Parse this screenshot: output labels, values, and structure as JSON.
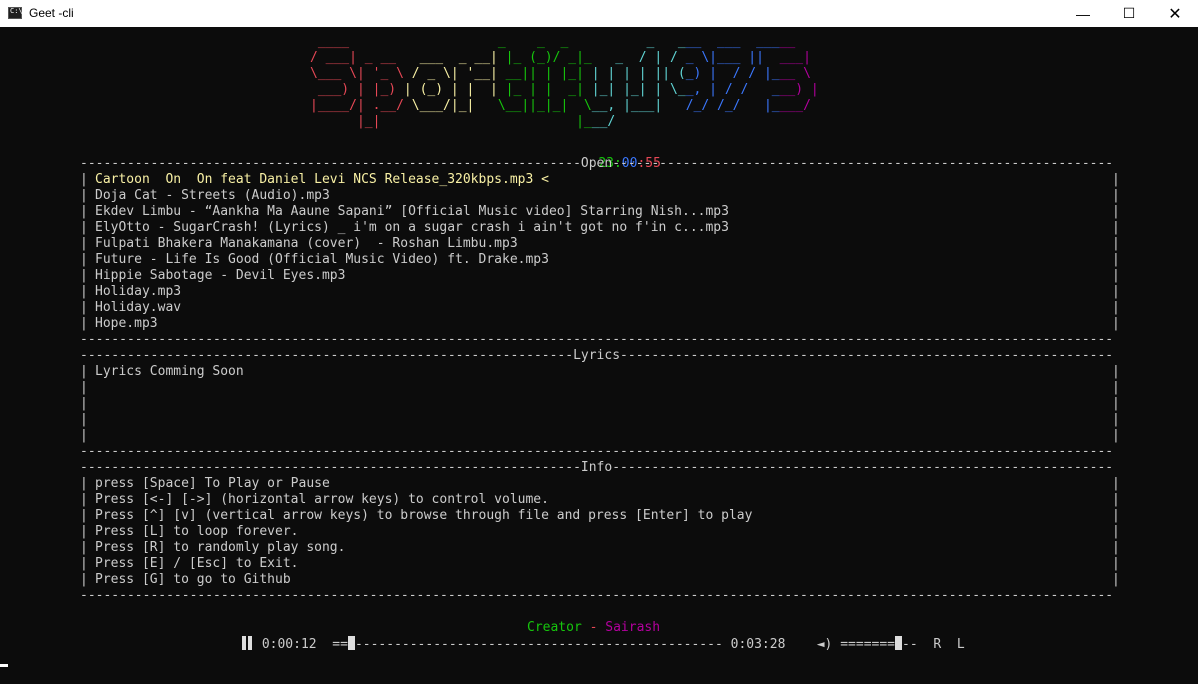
{
  "window": {
    "title": "Geet -cli",
    "minimize_glyph": "—",
    "maximize_glyph": "☐",
    "close_glyph": "✕"
  },
  "logo_lines": [
    " ____                   _    _  _          _   ___  ___  _____",
    "/ ___| _ __   ___  _ __| |_ (_)/ _|_   _  / | / _ \\|___ ||  ___|",
    "\\___ \\| '_ \\ / _ \\| '__| __|| | |_| | | | | || (_) |  / / |___ \\",
    " ___) | |_) | (_) | |  | |_ | |  _| |_| |_| | \\__, | / /   ___) |",
    "|____/| .__/ \\___/|_|   \\__||_|_|  \\__, |___|   /_/ /_/   |____/",
    "      |_|                         |___/"
  ],
  "logo_colors": [
    "#e74856",
    "#f9f1a5",
    "#16c60c",
    "#61d6d6",
    "#3b78ff",
    "#b4009e"
  ],
  "clock": {
    "hours": "23",
    "colon1": ":",
    "minutes": "00",
    "colon2": ":",
    "seconds": "55"
  },
  "sections": {
    "open_title": "Open",
    "lyrics_title": "Lyrics",
    "info_title": "Info"
  },
  "files": [
    "Cartoon  On  On feat Daniel Levi NCS Release_320kbps.mp3 <",
    "Doja Cat - Streets (Audio).mp3",
    "Ekdev Limbu - “Aankha Ma Aaune Sapani” [Official Music video] Starring Nish...mp3",
    "ElyOtto - SugarCrash! (Lyrics) _ i'm on a sugar crash i ain't got no f'in c...mp3",
    "Fulpati Bhakera Manakamana (cover)  - Roshan Limbu.mp3",
    "Future - Life Is Good (Official Music Video) ft. Drake.mp3",
    "Hippie Sabotage - Devil Eyes.mp3",
    "Holiday.mp3",
    "Holiday.wav",
    "Hope.mp3"
  ],
  "lyrics": [
    "Lyrics Comming Soon",
    "",
    "",
    "",
    ""
  ],
  "info": [
    "press [Space] To Play or Pause",
    "Press [<-] [->] (horizontal arrow keys) to control volume.",
    "Press [^] [v] (vertical arrow keys) to browse through file and press [Enter] to play",
    "Press [L] to loop forever.",
    "Press [R] to randomly play song.",
    "Press [E] / [Esc] to Exit.",
    "Press [G] to go to Github"
  ],
  "footer": {
    "creator_label": "Creator",
    "dash": " - ",
    "author": "Sairash"
  },
  "player": {
    "elapsed": "0:00:12",
    "progress_before": "==",
    "progress_after": "-----------------------------------------------",
    "duration": "0:03:28",
    "volume_icon": "◄)",
    "volume_before": "=======",
    "volume_after": "--",
    "repeat_label": "R",
    "loop_label": "L",
    "progress_fraction": 0.058,
    "volume_fraction": 0.78
  },
  "colors": {
    "selected_file": "#f9f1a5",
    "clock_hours": "#16c60c",
    "clock_minutes": "#3b78ff",
    "clock_seconds": "#e74856",
    "creator": "#16c60c",
    "dash": "#e74856",
    "author": "#b4009e"
  }
}
